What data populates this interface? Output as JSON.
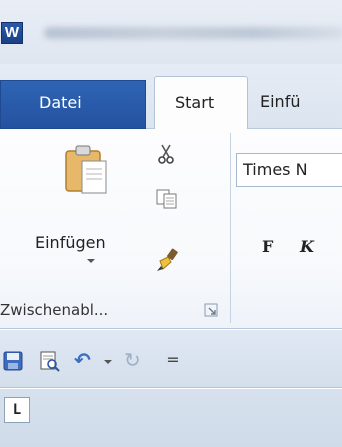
{
  "titlebar": {
    "app_icon_letter": "W"
  },
  "tabs": {
    "file": "Datei",
    "start": "Start",
    "insert": "Einfü"
  },
  "ribbon": {
    "paste_label": "Einfügen",
    "font_name": "Times N",
    "bold_label": "F",
    "italic_label": "K",
    "group_clipboard": "Zwischenabl..."
  },
  "quick_access": {
    "customize_glyph": "="
  },
  "ruler": {
    "tab_selector": "L"
  },
  "colors": {
    "file_tab": "#2a5aa8",
    "accent": "#3b6fc4"
  }
}
